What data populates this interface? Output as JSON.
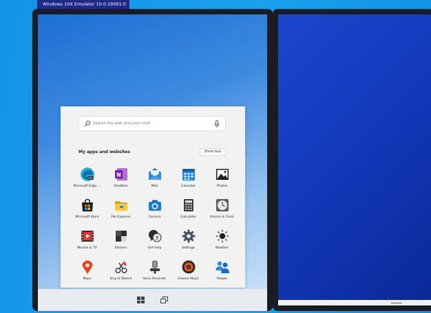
{
  "window": {
    "title": "Windows 10X Emulator 10.0.19561.0"
  },
  "search": {
    "placeholder": "Search the web and your stuff"
  },
  "start_menu": {
    "section_title": "My apps and websites",
    "show_less_label": "Show less",
    "apps": [
      {
        "label": "Microsoft Edge ...",
        "icon": "edge-dev-icon"
      },
      {
        "label": "OneNote",
        "icon": "onenote-icon"
      },
      {
        "label": "Mail",
        "icon": "mail-icon"
      },
      {
        "label": "Calendar",
        "icon": "calendar-icon"
      },
      {
        "label": "Photos",
        "icon": "photos-icon"
      },
      {
        "label": "Microsoft Store",
        "icon": "store-icon"
      },
      {
        "label": "File Explorer",
        "icon": "file-explorer-icon"
      },
      {
        "label": "Camera",
        "icon": "camera-icon"
      },
      {
        "label": "Calculator",
        "icon": "calculator-icon"
      },
      {
        "label": "Alarms & Clock",
        "icon": "alarms-clock-icon"
      },
      {
        "label": "Movies & TV",
        "icon": "movies-tv-icon"
      },
      {
        "label": "Stickies",
        "icon": "stickies-icon"
      },
      {
        "label": "Get Help",
        "icon": "get-help-icon"
      },
      {
        "label": "Settings",
        "icon": "settings-icon"
      },
      {
        "label": "Weather",
        "icon": "weather-icon"
      },
      {
        "label": "Maps",
        "icon": "maps-icon"
      },
      {
        "label": "Snip & Sketch",
        "icon": "snip-sketch-icon"
      },
      {
        "label": "Voice Recorder",
        "icon": "voice-recorder-icon"
      },
      {
        "label": "Groove Music",
        "icon": "groove-music-icon"
      },
      {
        "label": "People",
        "icon": "people-icon"
      }
    ]
  },
  "taskbar": {
    "icons": [
      "windows-start-icon",
      "task-view-icon"
    ]
  }
}
